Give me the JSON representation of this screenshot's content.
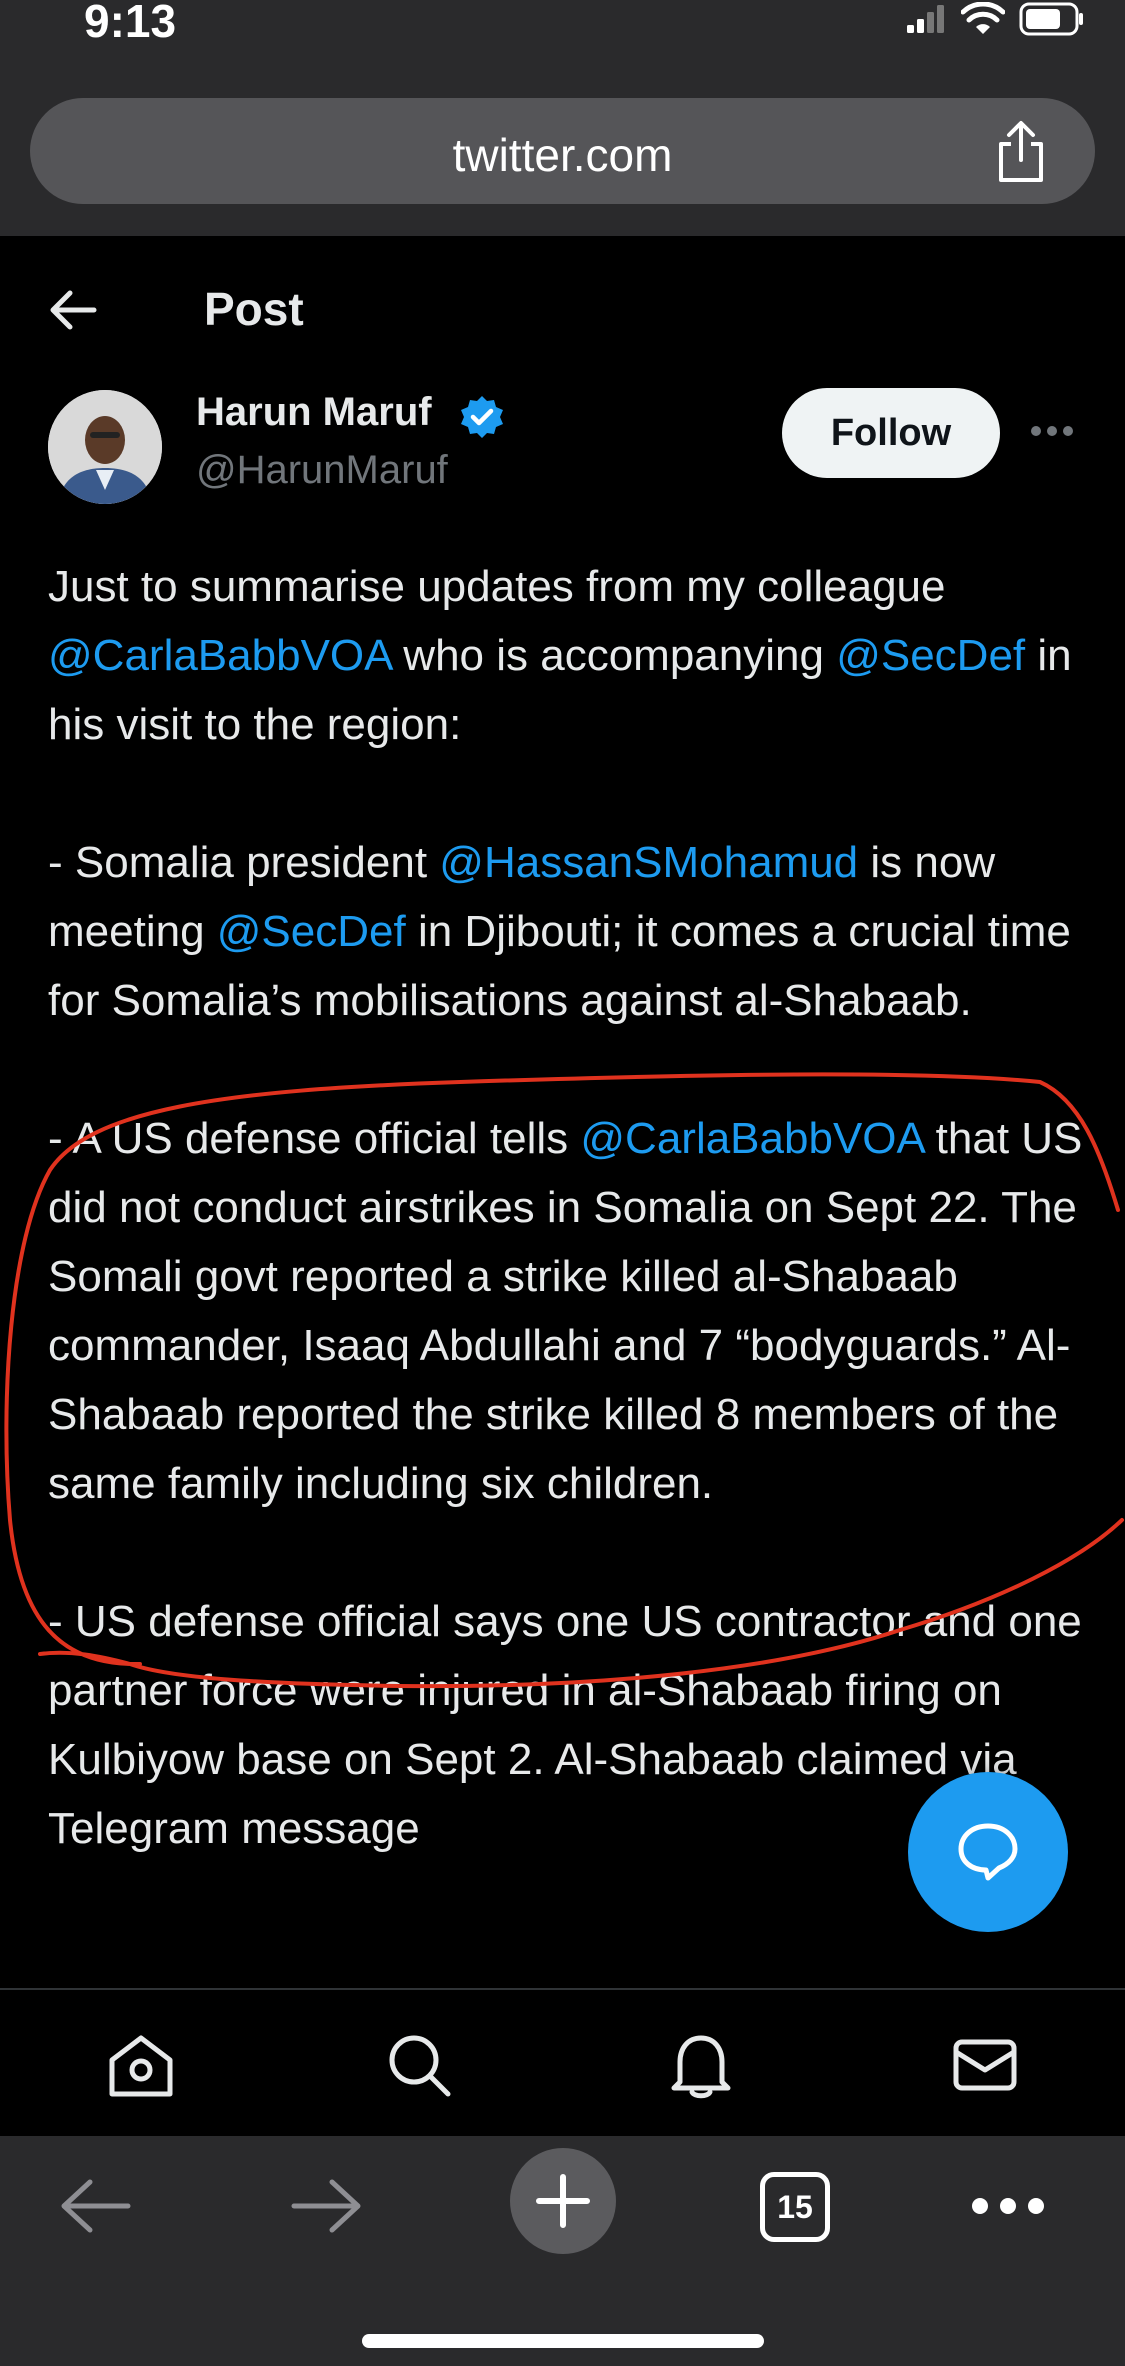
{
  "status_bar": {
    "time": "9:13"
  },
  "browser": {
    "url": "twitter.com"
  },
  "header": {
    "title": "Post"
  },
  "author": {
    "name": "Harun Maruf",
    "handle": "@HarunMaruf",
    "follow_label": "Follow"
  },
  "tweet": {
    "p1": {
      "t1": "Just to summarise updates from my colleague ",
      "m1": "@CarlaBabbVOA",
      "t2": " who is accompanying ",
      "m2": "@SecDef",
      "t3": " in his visit to the region:"
    },
    "p2": {
      "t1": "- Somalia president ",
      "m1": "@HassanSMohamud",
      "t2": " is now meeting ",
      "m2": "@SecDef",
      "t3": " in Djibouti; it comes a crucial time for Somalia’s mobilisations against al-Shabaab."
    },
    "p3": {
      "t1": "- A US defense official tells ",
      "m1": "@CarlaBabbVOA",
      "t2": " that US did not conduct airstrikes in Somalia on Sept 22. The Somali govt reported a strike killed al-Shabaab commander, Isaaq Abdullahi and 7 “bodyguards.” Al-Shabaab reported the strike killed 8 members of the same family including six children."
    },
    "p4": {
      "t1": "- US defense official says one US contractor and one partner force were injured in al-Shabaab firing on Kulbiyow base on Sept 2. Al-Shabaab claimed via Telegram message"
    }
  },
  "safari": {
    "tab_count": "15"
  },
  "colors": {
    "accent": "#1d9bf0",
    "annotation": "#e0321e",
    "background": "#000000"
  }
}
